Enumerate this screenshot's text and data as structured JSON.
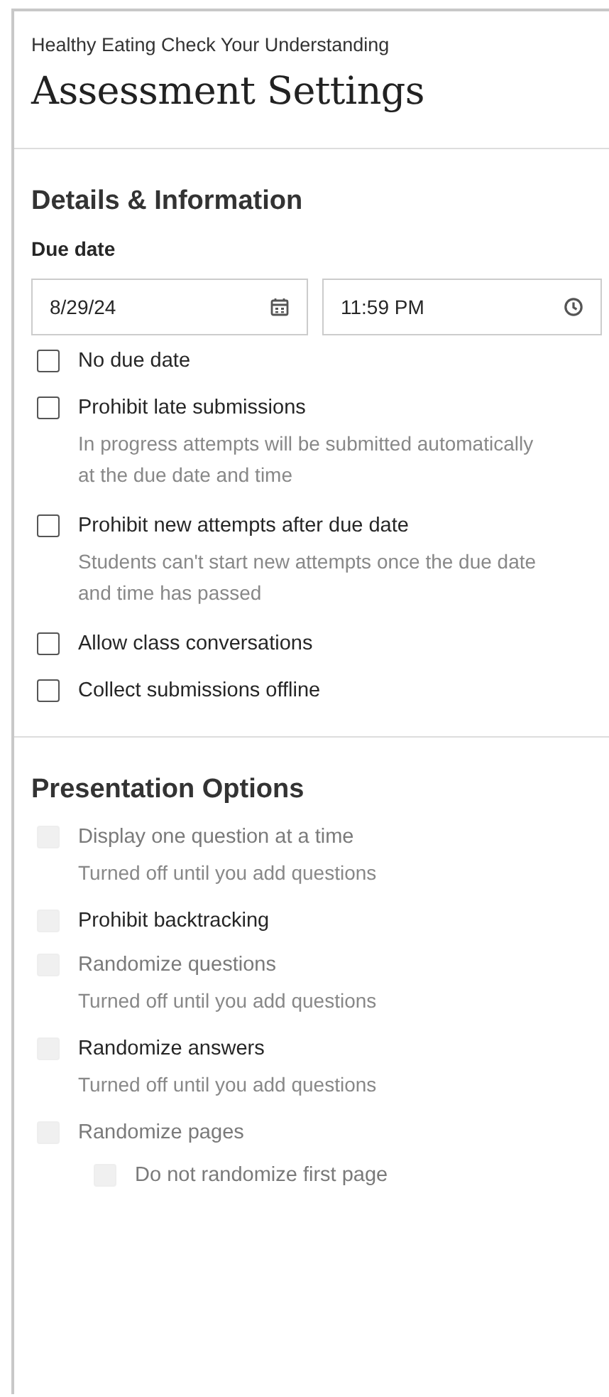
{
  "breadcrumb": "Healthy Eating Check Your Understanding",
  "title": "Assessment Settings",
  "sections": [
    {
      "heading": "Details & Information",
      "field_label": "Due date",
      "date": {
        "value": "8/29/24"
      },
      "time": {
        "value": "11:59 PM"
      },
      "options": [
        {
          "label": "No due date",
          "checked": false,
          "disabled": false,
          "dimmed": false
        },
        {
          "label": "Prohibit late submissions",
          "checked": false,
          "disabled": false,
          "dimmed": false,
          "description": "In progress attempts will be submitted automatically at the due date and time"
        },
        {
          "label": "Prohibit new attempts after due date",
          "checked": false,
          "disabled": false,
          "dimmed": false,
          "description": "Students can't start new attempts once the due date and time has passed"
        },
        {
          "label": "Allow class conversations",
          "checked": false,
          "disabled": false,
          "dimmed": false
        },
        {
          "label": "Collect submissions offline",
          "checked": false,
          "disabled": false,
          "dimmed": false
        }
      ]
    },
    {
      "heading": "Presentation Options",
      "options": [
        {
          "label": "Display one question at a time",
          "checked": false,
          "disabled": true,
          "dimmed": true,
          "description": "Turned off until you add questions"
        },
        {
          "label": "Prohibit backtracking",
          "checked": false,
          "disabled": true,
          "dimmed": false
        },
        {
          "label": "Randomize questions",
          "checked": false,
          "disabled": true,
          "dimmed": true,
          "description": "Turned off until you add questions"
        },
        {
          "label": "Randomize answers",
          "checked": false,
          "disabled": true,
          "dimmed": false,
          "description": "Turned off until you add questions"
        },
        {
          "label": "Randomize pages",
          "checked": false,
          "disabled": true,
          "dimmed": true,
          "children": [
            {
              "label": "Do not randomize first page",
              "checked": false,
              "disabled": true,
              "dimmed": true
            }
          ]
        }
      ]
    }
  ]
}
